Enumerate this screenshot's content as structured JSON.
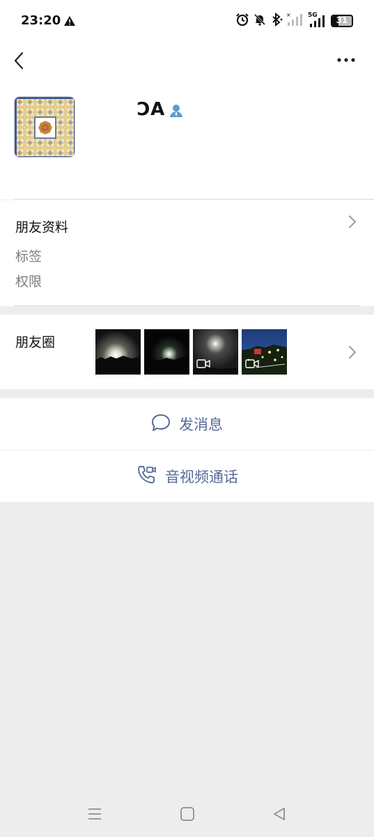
{
  "status_bar": {
    "time": "23:20",
    "network_label": "5G",
    "battery_level": "31",
    "battery_percent": 31
  },
  "profile": {
    "display_name": "ϽA"
  },
  "info": {
    "friend_profile_label": "朋友资料",
    "tags_label": "标签",
    "permissions_label": "权限"
  },
  "moments": {
    "label": "朋友圈",
    "thumbnails": [
      {
        "kind": "photo",
        "desc": "night-glow"
      },
      {
        "kind": "photo",
        "desc": "night-moon"
      },
      {
        "kind": "video",
        "desc": "moon-sky"
      },
      {
        "kind": "video",
        "desc": "night-lights"
      }
    ]
  },
  "actions": {
    "send_message_label": "发消息",
    "av_call_label": "音视频通话"
  },
  "colors": {
    "link_blue": "#576b95",
    "background": "#ededed",
    "card": "#ffffff"
  }
}
